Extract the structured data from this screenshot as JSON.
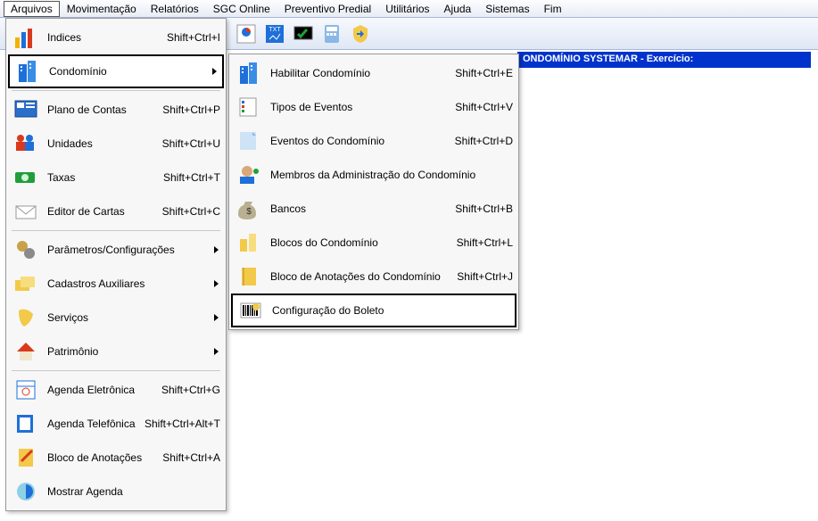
{
  "menubar": [
    "Arquivos",
    "Movimentação",
    "Relatórios",
    "SGC Online",
    "Preventivo Predial",
    "Utilitários",
    "Ajuda",
    "Sistemas",
    "Fim"
  ],
  "menubar_selected_index": 0,
  "status_strip": "ONDOMÍNIO SYSTEMAR - Exercício:",
  "menu1": [
    {
      "label": "Indices",
      "shortcut": "Shift+Ctrl+I",
      "icon": "chart-icon",
      "highlight": false
    },
    {
      "label": "Condomínio",
      "shortcut": "",
      "icon": "building-icon",
      "highlight": true,
      "arrow": true
    },
    {
      "sep": true
    },
    {
      "label": "Plano de Contas",
      "shortcut": "Shift+Ctrl+P",
      "icon": "plan-icon"
    },
    {
      "label": "Unidades",
      "shortcut": "Shift+Ctrl+U",
      "icon": "people-icon"
    },
    {
      "label": "Taxas",
      "shortcut": "Shift+Ctrl+T",
      "icon": "money-icon"
    },
    {
      "label": "Editor de Cartas",
      "shortcut": "Shift+Ctrl+C",
      "icon": "mail-icon"
    },
    {
      "sep": true
    },
    {
      "label": "Parâmetros/Configurações",
      "shortcut": "",
      "icon": "gears-icon",
      "arrow": true
    },
    {
      "label": "Cadastros Auxiliares",
      "shortcut": "",
      "icon": "folders-icon",
      "arrow": true
    },
    {
      "label": "Serviços",
      "shortcut": "",
      "icon": "glove-icon",
      "arrow": true
    },
    {
      "label": "Patrimônio",
      "shortcut": "",
      "icon": "home-icon",
      "arrow": true
    },
    {
      "sep": true
    },
    {
      "label": "Agenda Eletrônica",
      "shortcut": "Shift+Ctrl+G",
      "icon": "agenda-icon"
    },
    {
      "label": "Agenda Telefônica",
      "shortcut": "Shift+Ctrl+Alt+T",
      "icon": "phone-agenda-icon"
    },
    {
      "label": "Bloco de Anotações",
      "shortcut": "Shift+Ctrl+A",
      "icon": "notepad-icon"
    },
    {
      "label": "Mostrar Agenda",
      "shortcut": "",
      "icon": "show-agenda-icon"
    }
  ],
  "menu2": [
    {
      "label": "Habilitar Condomínio",
      "shortcut": "Shift+Ctrl+E",
      "icon": "building-icon"
    },
    {
      "label": "Tipos de Eventos",
      "shortcut": "Shift+Ctrl+V",
      "icon": "events-list-icon"
    },
    {
      "label": "Eventos do Condomínio",
      "shortcut": "Shift+Ctrl+D",
      "icon": "note-icon"
    },
    {
      "label": "Membros da Administração do Condomínio",
      "shortcut": "",
      "icon": "members-icon"
    },
    {
      "label": "Bancos",
      "shortcut": "Shift+Ctrl+B",
      "icon": "money-bag-icon"
    },
    {
      "label": "Blocos do Condomínio",
      "shortcut": "Shift+Ctrl+L",
      "icon": "blocks-icon"
    },
    {
      "label": "Bloco de Anotações do Condomínio",
      "shortcut": "Shift+Ctrl+J",
      "icon": "notebook-icon"
    },
    {
      "label": "Configuração do Boleto",
      "shortcut": "",
      "icon": "barcode-icon",
      "highlight": true
    }
  ],
  "toolbar_icons": [
    "report-icon",
    "txt-icon",
    "monitor-check-icon",
    "calculator-icon",
    "shield-arrow-icon"
  ]
}
